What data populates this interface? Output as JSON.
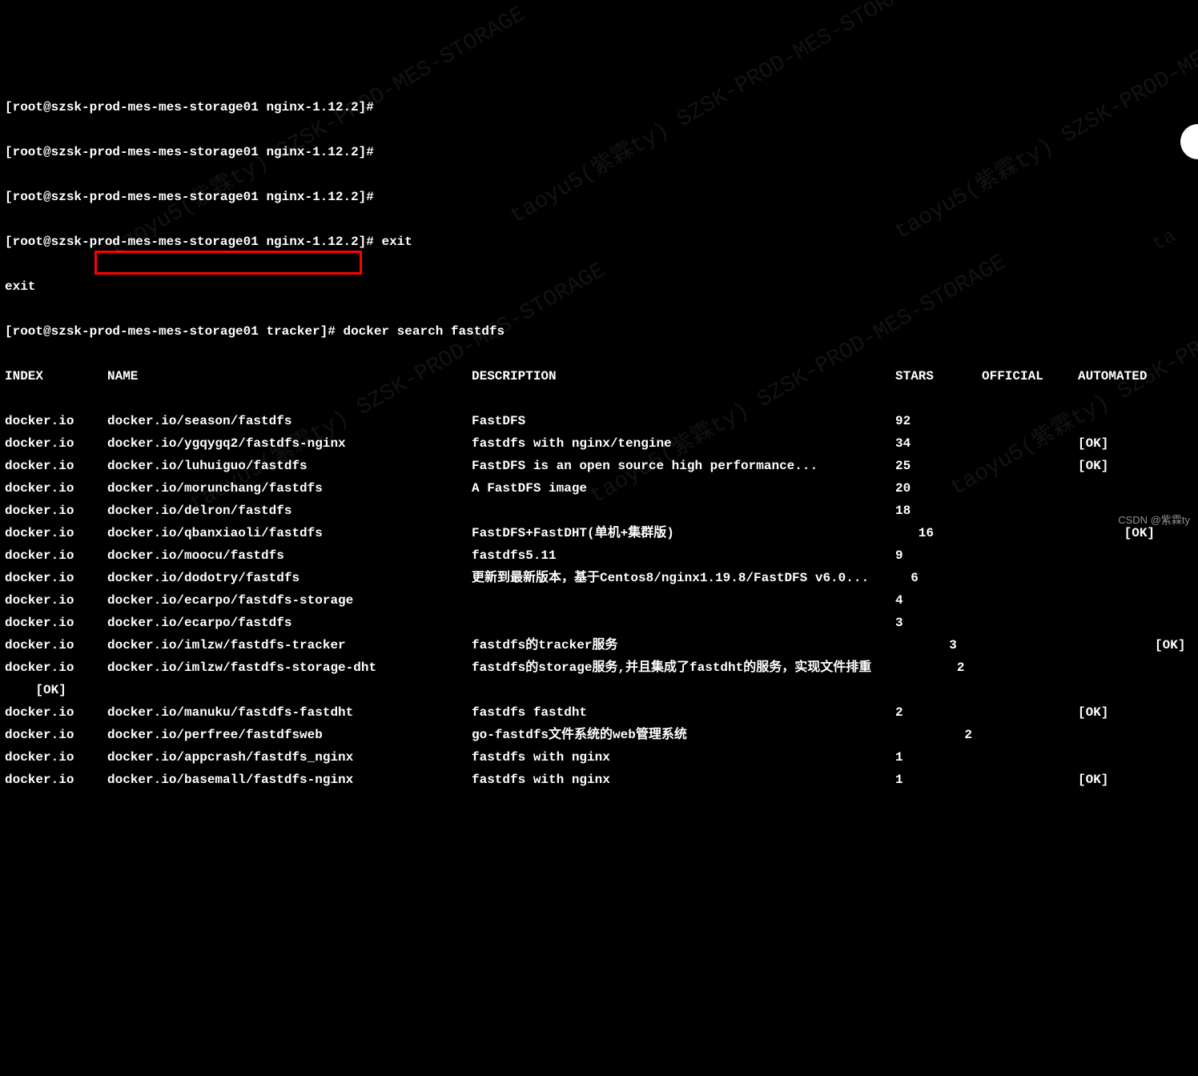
{
  "prompts": [
    "[root@szsk-prod-mes-mes-storage01 nginx-1.12.2]#",
    "[root@szsk-prod-mes-mes-storage01 nginx-1.12.2]#",
    "[root@szsk-prod-mes-mes-storage01 nginx-1.12.2]#",
    "[root@szsk-prod-mes-mes-storage01 nginx-1.12.2]# exit"
  ],
  "exit_echo": "exit",
  "search_prompt": "[root@szsk-prod-mes-mes-storage01 tracker]# docker search fastdfs",
  "headers": {
    "index": "INDEX",
    "name": "NAME",
    "description": "DESCRIPTION",
    "stars": "STARS",
    "official": "OFFICIAL",
    "automated": "AUTOMATED"
  },
  "rows": [
    {
      "index": "docker.io",
      "name": "docker.io/season/fastdfs",
      "desc": "FastDFS",
      "stars": "92",
      "official": "",
      "auto": ""
    },
    {
      "index": "docker.io",
      "name": "docker.io/ygqygq2/fastdfs-nginx",
      "desc": "fastdfs with nginx/tengine",
      "stars": "34",
      "official": "",
      "auto": "[OK]"
    },
    {
      "index": "docker.io",
      "name": "docker.io/luhuiguo/fastdfs",
      "desc": "FastDFS is an open source high performance...",
      "stars": "25",
      "official": "",
      "auto": "[OK]"
    },
    {
      "index": "docker.io",
      "name": "docker.io/morunchang/fastdfs",
      "desc": "A FastDFS image",
      "stars": "20",
      "official": "",
      "auto": ""
    },
    {
      "index": "docker.io",
      "name": "docker.io/delron/fastdfs",
      "desc": "",
      "stars": "18",
      "official": "",
      "auto": ""
    },
    {
      "index": "docker.io",
      "name": "docker.io/qbanxiaoli/fastdfs",
      "desc": "FastDFS+FastDHT(单机+集群版)",
      "stars": "   16",
      "official": "",
      "auto": "      [OK]"
    },
    {
      "index": "docker.io",
      "name": "docker.io/moocu/fastdfs",
      "desc": "fastdfs5.11",
      "stars": "9",
      "official": "",
      "auto": ""
    },
    {
      "index": "docker.io",
      "name": "docker.io/dodotry/fastdfs",
      "desc": "更新到最新版本，基于Centos8/nginx1.19.8/FastDFS v6.0...",
      "stars": "  6",
      "official": "",
      "auto": ""
    },
    {
      "index": "docker.io",
      "name": "docker.io/ecarpo/fastdfs-storage",
      "desc": "",
      "stars": "4",
      "official": "",
      "auto": ""
    },
    {
      "index": "docker.io",
      "name": "docker.io/ecarpo/fastdfs",
      "desc": "",
      "stars": "3",
      "official": "",
      "auto": ""
    },
    {
      "index": "docker.io",
      "name": "docker.io/imlzw/fastdfs-tracker",
      "desc": "fastdfs的tracker服务",
      "stars": "       3",
      "official": "",
      "auto": "          [OK]"
    },
    {
      "index": "docker.io",
      "name": "docker.io/imlzw/fastdfs-storage-dht",
      "desc": "fastdfs的storage服务,并且集成了fastdht的服务，实现文件排重",
      "stars": "        2",
      "official": "",
      "auto": ""
    },
    {
      "index": "    [OK]",
      "name": "",
      "desc": "",
      "stars": "",
      "official": "",
      "auto": ""
    },
    {
      "index": "docker.io",
      "name": "docker.io/manuku/fastdfs-fastdht",
      "desc": "fastdfs fastdht",
      "stars": "2",
      "official": "",
      "auto": "[OK]"
    },
    {
      "index": "docker.io",
      "name": "docker.io/perfree/fastdfsweb",
      "desc": "go-fastdfs文件系统的web管理系统",
      "stars": "         2",
      "official": "",
      "auto": ""
    },
    {
      "index": "docker.io",
      "name": "docker.io/appcrash/fastdfs_nginx",
      "desc": "fastdfs with nginx",
      "stars": "1",
      "official": "",
      "auto": ""
    },
    {
      "index": "docker.io",
      "name": "docker.io/basemall/fastdfs-nginx",
      "desc": "fastdfs with nginx",
      "stars": "1",
      "official": "",
      "auto": "[OK]"
    }
  ],
  "watermark": "taoyu5(紫霖ty) SZSK-PROD-MES-STORAGE",
  "attribution": "CSDN @紫霖ty"
}
